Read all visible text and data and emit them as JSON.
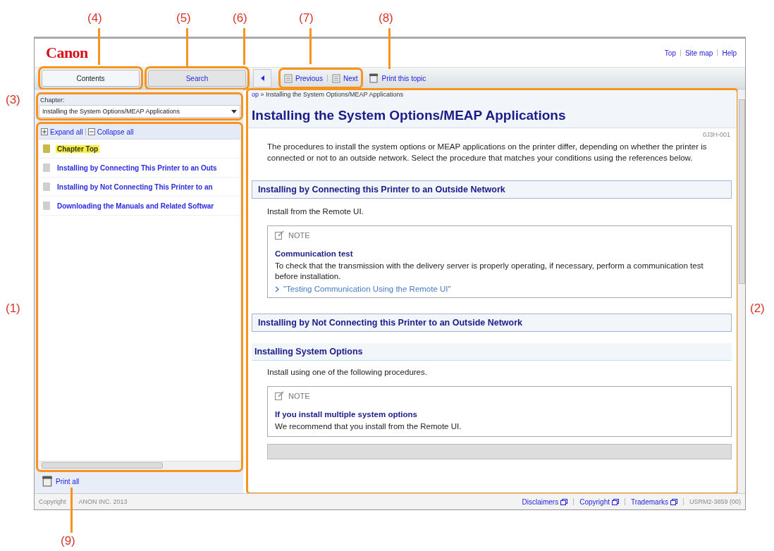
{
  "callouts": [
    {
      "label": "(4)"
    },
    {
      "label": "(5)"
    },
    {
      "label": "(6)"
    },
    {
      "label": "(7)"
    },
    {
      "label": "(8)"
    },
    {
      "label": "(3)"
    },
    {
      "label": "(1)"
    },
    {
      "label": "(2)"
    },
    {
      "label": "(9)"
    }
  ],
  "header": {
    "logo": "Canon",
    "links": [
      "Top",
      "Site map",
      "Help"
    ]
  },
  "tabs": [
    {
      "label": "Contents",
      "selected": true
    },
    {
      "label": "Search",
      "selected": false
    }
  ],
  "toolbar": {
    "previous": "Previous",
    "next": "Next",
    "print": "Print this topic"
  },
  "chapter": {
    "label": "Chapter:",
    "value": "Installing the System Options/MEAP Applications"
  },
  "tree_actions": [
    "Expand all",
    "Collapse all"
  ],
  "tree": [
    {
      "label": "Chapter Top",
      "selected": true
    },
    {
      "label": "Installing by Connecting This Printer to an Outs",
      "selected": false
    },
    {
      "label": "Installing by Not Connecting This Printer to an",
      "selected": false
    },
    {
      "label": "Downloading the Manuals and Related Softwar",
      "selected": false
    }
  ],
  "print_all": "Print all",
  "content": {
    "breadcrumb_link": "op",
    "breadcrumb": "» Installing the System Options/MEAP Applications",
    "title": "Installing the System Options/MEAP Applications",
    "doc_id": "0J3H-001",
    "blocks": [
      {
        "kind": "paragraph",
        "text": "The procedures to install the system options or MEAP applications on the printer differ, depending on whether the printer is connected or not to an outside network. Select the procedure that matches your conditions using the references below."
      },
      {
        "kind": "heading",
        "text": "Installing by Connecting this Printer to an Outside Network"
      },
      {
        "kind": "paragraph",
        "text": "Install from the Remote UI."
      },
      {
        "kind": "note",
        "label": "NOTE",
        "title": "Communication test",
        "text": "To check that the transmission with the delivery server is properly operating, if necessary, perform a communication test before installation.",
        "link": "\"Testing Communication Using the Remote UI\""
      },
      {
        "kind": "heading",
        "text": "Installing by Not Connecting this Printer to an Outside Network"
      },
      {
        "kind": "subheading",
        "text": "Installing System Options"
      },
      {
        "kind": "paragraph",
        "text": "Install using one of the following procedures."
      },
      {
        "kind": "note",
        "label": "NOTE",
        "title": "If you install multiple system options",
        "text": "We recommend that you install from the Remote UI."
      },
      {
        "kind": "table"
      }
    ]
  },
  "footer": {
    "copyright": "Copyright",
    "owner": "ANON INC. 2013",
    "links": [
      "Disclaimers",
      "Copyright",
      "Trademarks"
    ],
    "code": "USRM2-3859 (00)"
  }
}
